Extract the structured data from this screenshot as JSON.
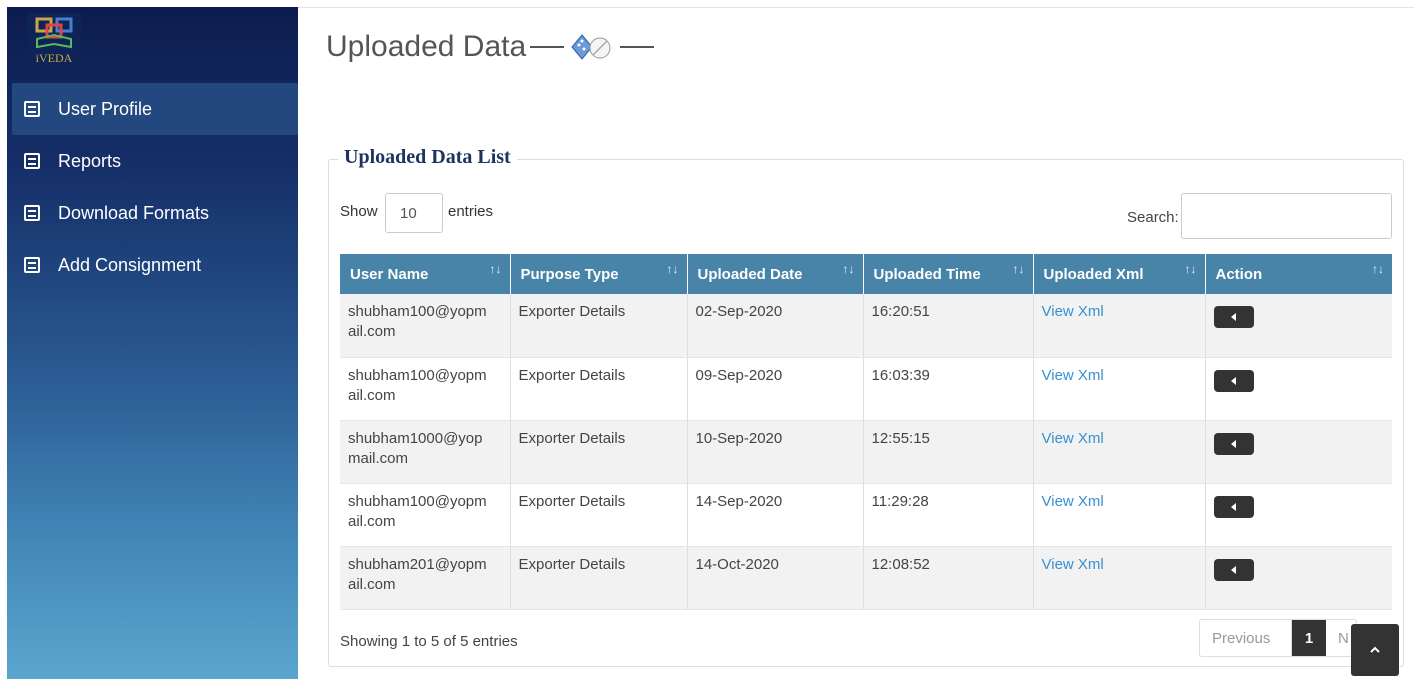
{
  "brand": {
    "logo_text": "iVEDA"
  },
  "sidebar": {
    "items": [
      {
        "label": "User Profile",
        "icon": "list-icon",
        "active": true
      },
      {
        "label": "Reports",
        "icon": "list-icon"
      },
      {
        "label": "Download Formats",
        "icon": "list-icon"
      },
      {
        "label": "Add Consignment",
        "icon": "list-icon"
      }
    ]
  },
  "page": {
    "title": "Uploaded Data"
  },
  "panel": {
    "legend": "Uploaded Data List",
    "show_label": "Show",
    "page_size": "10",
    "entries_label": "entries",
    "search_label": "Search:",
    "search_value": ""
  },
  "table": {
    "columns": [
      "User Name",
      "Purpose Type",
      "Uploaded Date",
      "Uploaded Time",
      "Uploaded Xml",
      "Action"
    ],
    "rows": [
      {
        "user": "shubham100@yopm\nail.com",
        "purpose": "Exporter Details",
        "date": "02-Sep-2020",
        "time": "16:20:51",
        "xml": "View Xml"
      },
      {
        "user": "shubham100@yopm\nail.com",
        "purpose": "Exporter Details",
        "date": "09-Sep-2020",
        "time": "16:03:39",
        "xml": "View Xml"
      },
      {
        "user": "shubham1000@yop\nmail.com",
        "purpose": "Exporter Details",
        "date": "10-Sep-2020",
        "time": "12:55:15",
        "xml": "View Xml"
      },
      {
        "user": "shubham100@yopm\nail.com",
        "purpose": "Exporter Details",
        "date": "14-Sep-2020",
        "time": "11:29:28",
        "xml": "View Xml"
      },
      {
        "user": "shubham201@yopm\nail.com",
        "purpose": "Exporter Details",
        "date": "14-Oct-2020",
        "time": "12:08:52",
        "xml": "View Xml"
      }
    ]
  },
  "footer": {
    "info": "Showing 1 to 5 of 5 entries",
    "previous": "Previous",
    "current_page": "1",
    "next": "N"
  },
  "colors": {
    "header_bg": "#4883a8",
    "link": "#3a8fd0",
    "sidebar_top": "#0d1c4e",
    "sidebar_bottom": "#5aa6cf"
  }
}
